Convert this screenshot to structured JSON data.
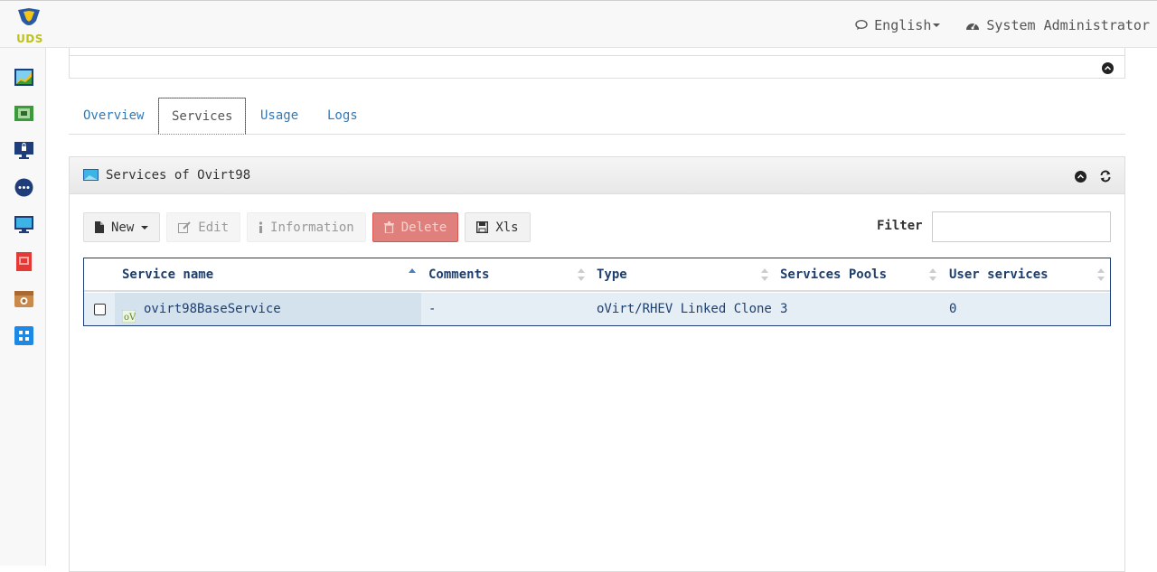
{
  "app": {
    "logo_text": "UDS"
  },
  "navbar": {
    "language": "English",
    "user": "System Administrator"
  },
  "sidebar": {
    "items": [
      {
        "icon": "dashboard-icon"
      },
      {
        "icon": "services-icon"
      },
      {
        "icon": "authenticators-icon"
      },
      {
        "icon": "connectivity-icon"
      },
      {
        "icon": "pools-icon"
      },
      {
        "icon": "reports-icon"
      },
      {
        "icon": "tools-icon"
      },
      {
        "icon": "configuration-icon"
      }
    ]
  },
  "tabs": [
    {
      "label": "Overview"
    },
    {
      "label": "Services"
    },
    {
      "label": "Usage"
    },
    {
      "label": "Logs"
    }
  ],
  "active_tab": "Services",
  "panel": {
    "title": "Services of Ovirt98"
  },
  "toolbar": {
    "new_label": "New",
    "edit_label": "Edit",
    "info_label": "Information",
    "delete_label": "Delete",
    "xls_label": "Xls"
  },
  "filter": {
    "label": "Filter",
    "value": ""
  },
  "table": {
    "columns": [
      "Service name",
      "Comments",
      "Type",
      "Services Pools",
      "User services"
    ],
    "rows": [
      {
        "name": "ovirt98BaseService",
        "comments": "-",
        "type": "oVirt/RHEV Linked Clone",
        "pools": "3",
        "user_services": "0"
      }
    ]
  },
  "colors": {
    "link": "#337ab7",
    "danger": "#d9534f",
    "table_border": "#1f3d7a",
    "row_bg": "#e6eef5"
  }
}
